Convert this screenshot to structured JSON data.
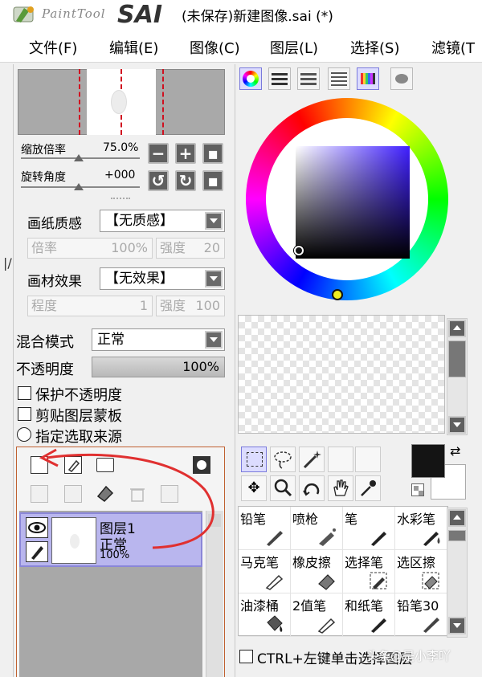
{
  "app": {
    "logo_text": "PaintTool",
    "logo_sai": "SAI",
    "window_title": "(未保存)新建图像.sai (*)"
  },
  "menu": [
    "文件(F)",
    "编辑(E)",
    "图像(C)",
    "图层(L)",
    "选择(S)",
    "滤镜(T"
  ],
  "navigator": {
    "zoom_label": "缩放倍率",
    "zoom_value": "75.0%",
    "rotate_label": "旋转角度",
    "rotate_value": "+000"
  },
  "canvas_settings": {
    "paper_label": "画纸质感",
    "paper_value": "【无质感】",
    "scale_label": "倍率",
    "scale_value": "100%",
    "strength_label": "强度",
    "strength_value": "20",
    "material_label": "画材效果",
    "material_value": "【无效果】",
    "degree_label": "程度",
    "degree_value": "1",
    "strength2_label": "强度",
    "strength2_value": "100"
  },
  "layer_props": {
    "blend_label": "混合模式",
    "blend_value": "正常",
    "opacity_label": "不透明度",
    "opacity_value": "100%",
    "protect_opacity": "保护不透明度",
    "clip_mask": "剪贴图层蒙板",
    "selection_source": "指定选取来源"
  },
  "layers": [
    {
      "name": "图层1",
      "mode": "正常",
      "opacity": "100%"
    }
  ],
  "brushes": [
    {
      "name": "铅笔"
    },
    {
      "name": "喷枪"
    },
    {
      "name": "笔"
    },
    {
      "name": "水彩笔"
    },
    {
      "name": "马克笔"
    },
    {
      "name": "橡皮擦"
    },
    {
      "name": "选择笔"
    },
    {
      "name": "选区擦"
    },
    {
      "name": "油漆桶"
    },
    {
      "name": "2值笔"
    },
    {
      "name": "和纸笔"
    },
    {
      "name": "铅笔30"
    }
  ],
  "footer": {
    "ctrl_label": "CTRL+左键单击选择图层",
    "watermark": "头条@是小李吖"
  },
  "colors": {
    "foreground": "#141414",
    "background": "#ffffff",
    "layer_highlight": "#b9b6ee",
    "annotation_arrow": "#e03030"
  }
}
